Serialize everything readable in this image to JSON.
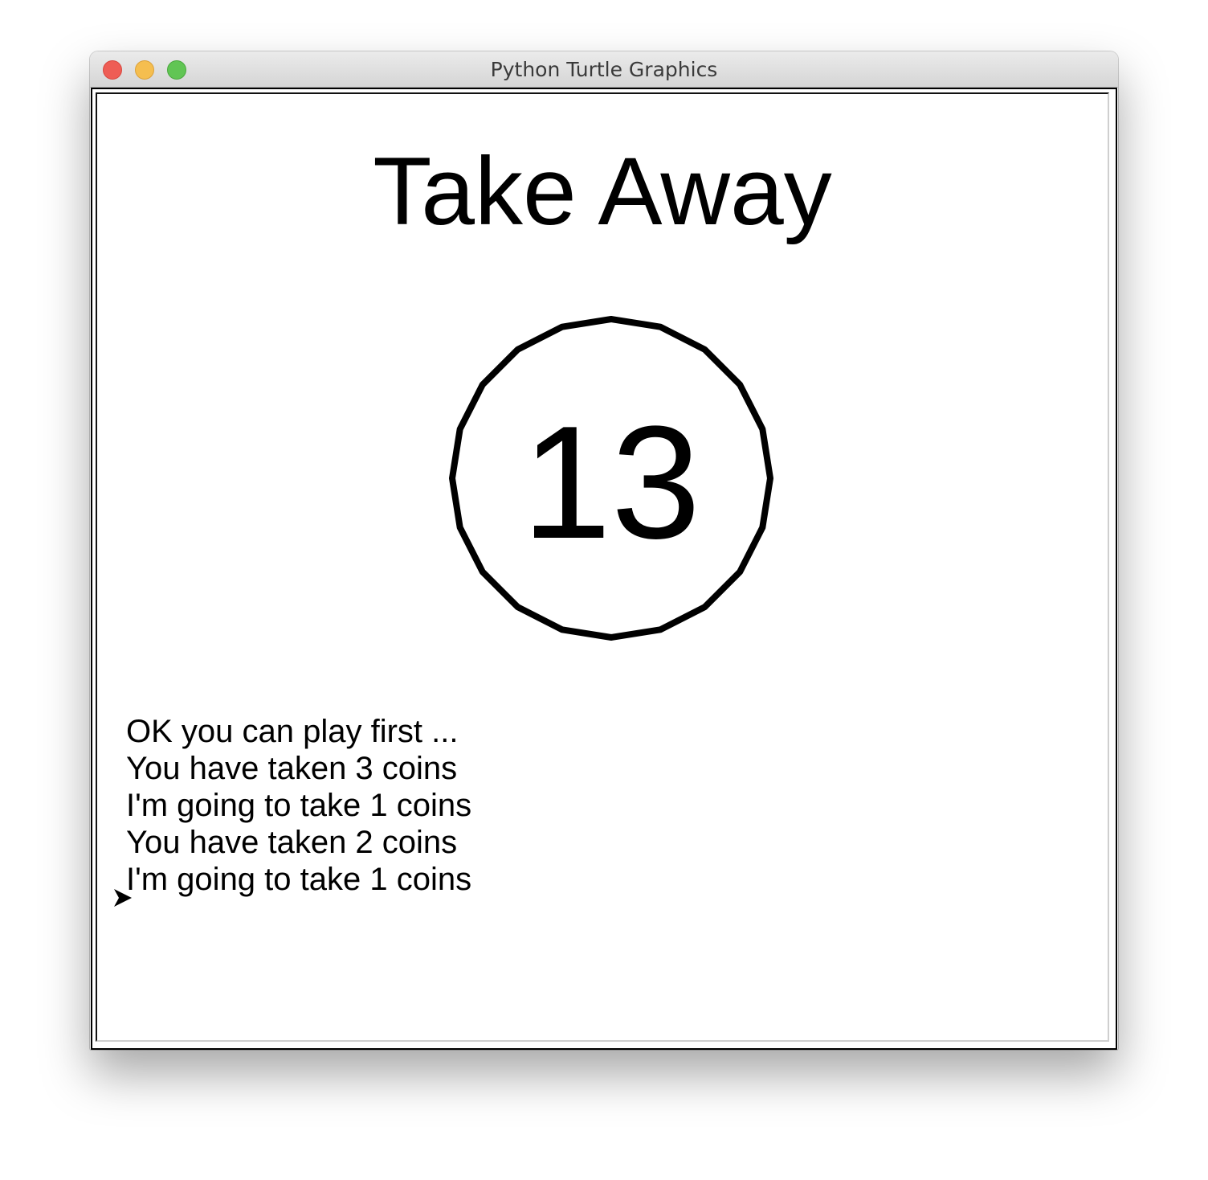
{
  "window": {
    "title": "Python Turtle Graphics"
  },
  "game": {
    "title": "Take Away",
    "coins_remaining": "13",
    "messages": [
      "OK you can play first ...",
      "You have taken 3 coins",
      "I'm going to take 1 coins",
      "You have taken 2 coins",
      "I'm going to take 1 coins"
    ]
  },
  "colors": {
    "close": "#ee5d55",
    "minimize": "#f5be4f",
    "maximize": "#61c554",
    "ink": "#000000"
  },
  "icons": {
    "turtle_cursor": "arrow-cursor-icon"
  }
}
